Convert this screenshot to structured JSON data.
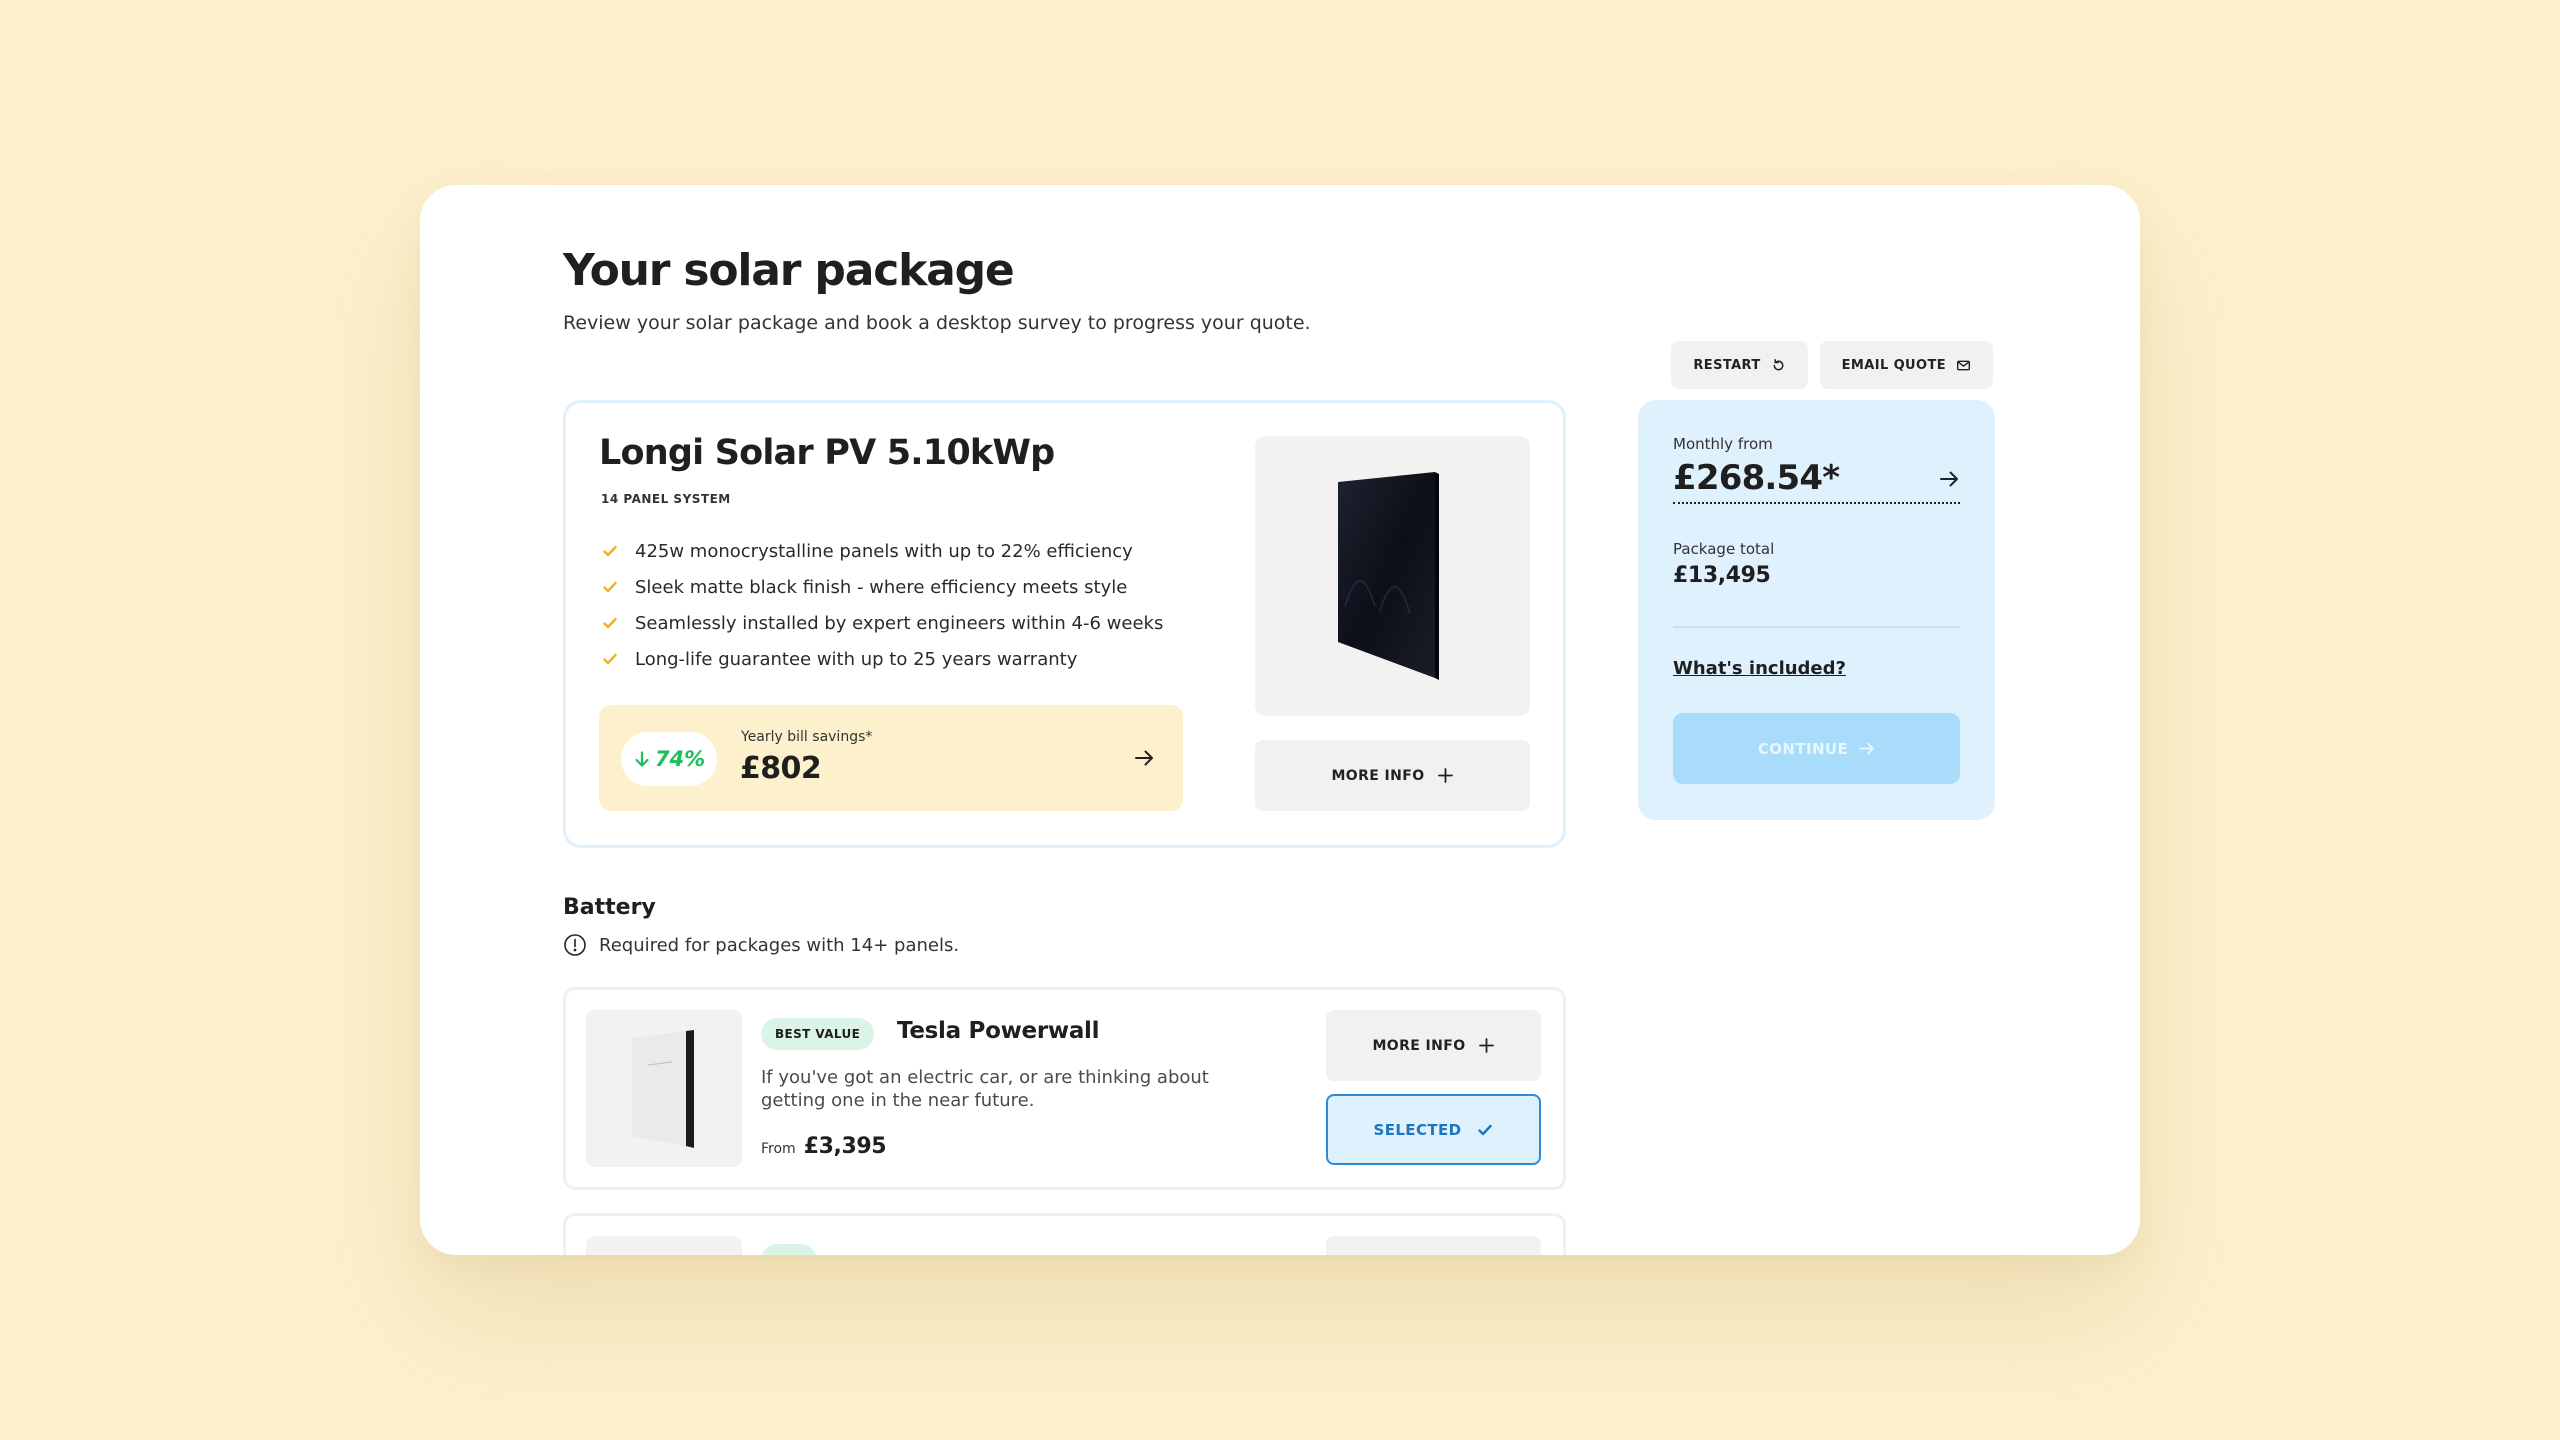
{
  "header": {
    "title": "Your solar package",
    "subtitle": "Review your solar package and book a desktop survey to progress your quote.",
    "restart_label": "RESTART",
    "email_label": "EMAIL QUOTE"
  },
  "package": {
    "title": "Longi Solar PV 5.10kWp",
    "subtitle": "14 PANEL SYSTEM",
    "features": [
      "425w monocrystalline panels with up to 22% efficiency",
      "Sleek matte black finish - where efficiency meets style",
      "Seamlessly installed by expert engineers within 4-6 weeks",
      "Long-life guarantee with up to 25 years warranty"
    ],
    "savings_percent": "74%",
    "savings_label": "Yearly bill savings*",
    "savings_value": "£802",
    "more_info": "MORE INFO"
  },
  "summary": {
    "monthly_label": "Monthly from",
    "monthly_value": "£268.54*",
    "total_label": "Package total",
    "total_value": "£13,495",
    "included_link": "What's included?",
    "continue_label": "CONTINUE"
  },
  "battery": {
    "title": "Battery",
    "note": "Required for packages with 14+ panels.",
    "items": [
      {
        "badge": "BEST VALUE",
        "name": "Tesla Powerwall",
        "description": "If you've got an electric car, or are thinking about getting one in the near future.",
        "from_label": "From",
        "price": "£3,395",
        "more_info": "MORE INFO",
        "selected_label": "SELECTED"
      }
    ]
  },
  "colors": {
    "page_bg": "#fdf0cd",
    "accent_blue": "#2c8ad6",
    "savings_green": "#1bbf5b",
    "check_yellow": "#f2b01e",
    "summary_bg": "#dff1fd"
  }
}
